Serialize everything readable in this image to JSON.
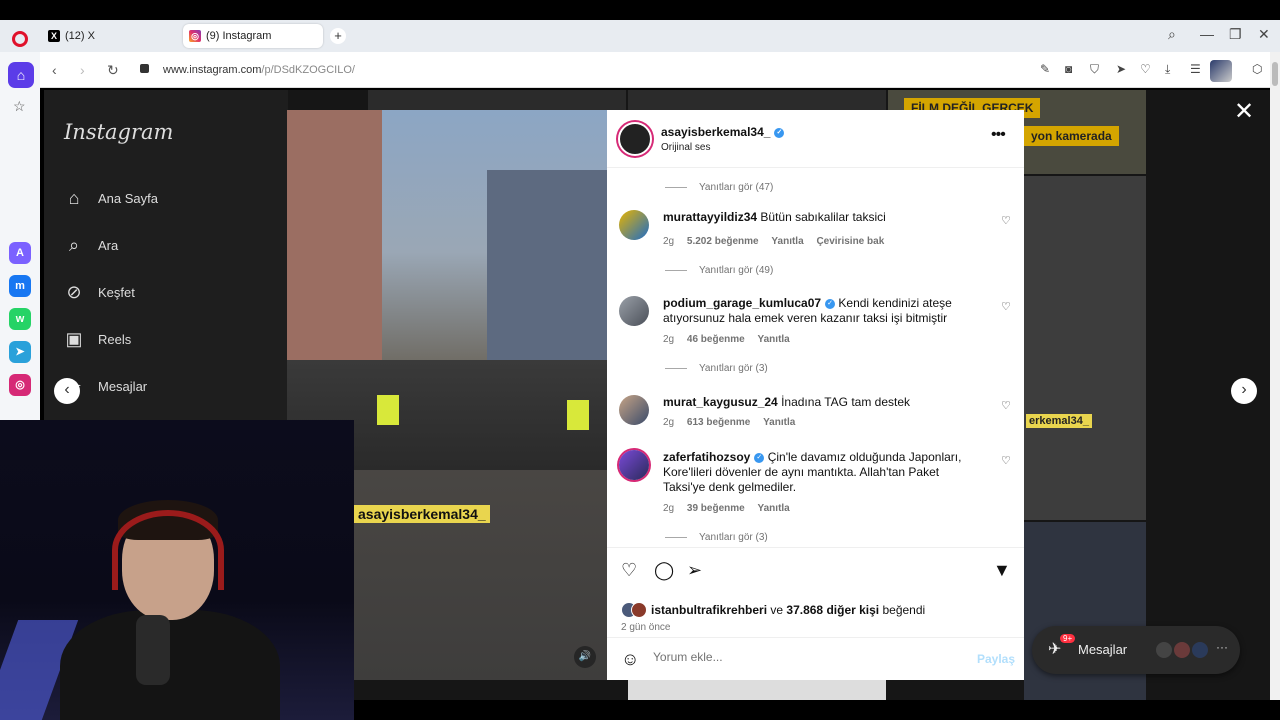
{
  "browser": {
    "tabs": [
      {
        "label": "(12) X"
      },
      {
        "label": "(9) Instagram"
      }
    ],
    "url_host": "www.instagram.com",
    "url_path": "/p/DSdKZOGCILO/"
  },
  "instagram": {
    "logo": "Instagram",
    "nav": [
      {
        "label": "Ana Sayfa"
      },
      {
        "label": "Ara"
      },
      {
        "label": "Keşfet"
      },
      {
        "label": "Reels"
      },
      {
        "label": "Mesajlar",
        "badge": "9+"
      }
    ],
    "tile_labels": [
      "FİLM DEĞİL GERÇEK",
      "yon kamerada",
      "erkemal34_"
    ]
  },
  "post": {
    "username": "asayisberkemal34_",
    "subtitle": "Orijinal ses",
    "watermark": "asayisberkemal34_",
    "comments": [
      {
        "user": "murattayyildiz34",
        "text": "Bütün sabıkalilar taksici",
        "time": "2g",
        "likes": "5.202 beğenme",
        "reply": "Yanıtla",
        "translate": "Çevirisine bak",
        "replies_link": "Yanıtları gör (49)"
      },
      {
        "user": "podium_garage_kumluca07",
        "text": "Kendi kendinizi ateşe atıyorsunuz hala emek veren kazanır taksi işi bitmiştir",
        "time": "2g",
        "likes": "46 beğenme",
        "reply": "Yanıtla",
        "replies_link": "Yanıtları gör (3)"
      },
      {
        "user": "murat_kaygusuz_24",
        "text": "İnadına TAG tam destek",
        "time": "2g",
        "likes": "613 beğenme",
        "reply": "Yanıtla"
      },
      {
        "user": "zaferfatihozsoy",
        "text": "Çin'le davamız olduğunda Japonları, Kore'lileri dövenler de aynı mantıkta. Allah'tan Paket Taksi'ye denk gelmediler.",
        "time": "2g",
        "likes": "39 beğenme",
        "reply": "Yanıtla",
        "replies_link": "Yanıtları gör (3)"
      }
    ],
    "top_replies_link": "Yanıtları gör (47)",
    "liked_by_user": "istanbultrafikrehberi",
    "liked_by_and": "ve",
    "liked_by_count": "37.868 diğer kişi",
    "liked_by_suffix": "beğendi",
    "date": "2 gün önce",
    "comment_placeholder": "Yorum ekle...",
    "share_label": "Paylaş"
  },
  "messages_float": {
    "label": "Mesajlar",
    "badge": "9+"
  },
  "colors": {
    "accent": "#3897f0",
    "opera_red": "#e0112b",
    "opera_home": "#5b3ce8"
  }
}
